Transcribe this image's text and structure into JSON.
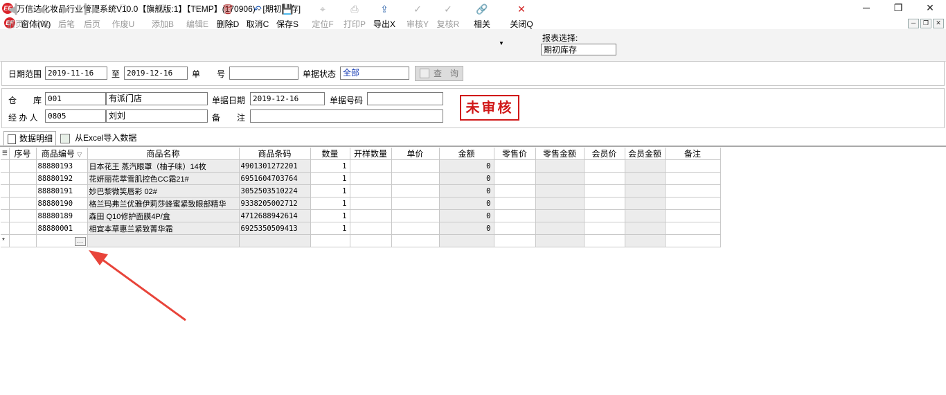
{
  "window": {
    "title": "万信达化妆品行业管理系统V10.0【旗舰版:1】【TEMP】(170906) - [期初库存]",
    "logo_text": "EF"
  },
  "menu": {
    "label": "窗体(W)"
  },
  "toolbar": {
    "buttons": [
      {
        "label": "前页",
        "icon": "◀▎",
        "enabled": false
      },
      {
        "label": "前笔",
        "icon": "◀",
        "enabled": false
      },
      {
        "label": "后笔",
        "icon": "▶",
        "enabled": false
      },
      {
        "label": "后页",
        "icon": "▎▶",
        "enabled": false
      },
      {
        "label": "作废U",
        "icon": "🗋",
        "enabled": false
      },
      {
        "label": "添加B",
        "icon": "🗋",
        "enabled": false
      },
      {
        "label": "编辑E",
        "icon": "✎",
        "enabled": false
      },
      {
        "label": "删除D",
        "icon": "🗑",
        "enabled": true
      },
      {
        "label": "取消C",
        "icon": "↶",
        "enabled": true
      },
      {
        "label": "保存S",
        "icon": "💾",
        "enabled": true
      },
      {
        "label": "定位F",
        "icon": "⌖",
        "enabled": false
      },
      {
        "label": "打印P",
        "icon": "⎙",
        "enabled": false
      },
      {
        "label": "导出X",
        "icon": "⇪",
        "enabled": true
      },
      {
        "label": "审核Y",
        "icon": "✓",
        "enabled": false
      },
      {
        "label": "复核R",
        "icon": "✓",
        "enabled": false
      },
      {
        "label": "相关",
        "icon": "🔗",
        "enabled": true
      },
      {
        "label": "关闭Q",
        "icon": "✕",
        "enabled": true
      }
    ],
    "report_label": "报表选择:",
    "report_value": "期初库存"
  },
  "filter": {
    "date_label": "日期范围",
    "date_from": "2019-11-16",
    "to_label": "至",
    "date_to": "2019-12-16",
    "docno_label": "单　　号",
    "docno_value": "",
    "status_label": "单据状态",
    "status_value": "全部",
    "query_label": "查　询"
  },
  "header": {
    "warehouse_label": "仓　　库",
    "warehouse_code": "001",
    "warehouse_name": "有派门店",
    "docdate_label": "单据日期",
    "docdate_value": "2019-12-16",
    "docnum_label": "单据号码",
    "docnum_value": "",
    "handler_label": "经 办 人",
    "handler_code": "0805",
    "handler_name": "刘刘",
    "remark_label": "备　　注",
    "remark_value": "",
    "stamp": "未审核"
  },
  "tabs": [
    {
      "label": "数据明细",
      "icon": "doc-icon"
    },
    {
      "label": "从Excel导入数据",
      "icon": "excel-icon"
    }
  ],
  "grid": {
    "columns": [
      "序号",
      "商品编号",
      "商品名称",
      "商品条码",
      "数量",
      "开样数量",
      "单价",
      "金额",
      "零售价",
      "零售金额",
      "会员价",
      "会员金额",
      "备注"
    ],
    "rows": [
      {
        "code": "88880193",
        "name": "日本花王 蒸汽眼罩（柚子味）14枚",
        "barcode": "4901301272201",
        "qty": "1",
        "amount": "0"
      },
      {
        "code": "88880192",
        "name": "花妍丽花萃雪肌控色CC霜21#",
        "barcode": "6951604703764",
        "qty": "1",
        "amount": "0"
      },
      {
        "code": "88880191",
        "name": "妙巴黎微笑唇彩 02#",
        "barcode": "3052503510224",
        "qty": "1",
        "amount": "0"
      },
      {
        "code": "88880190",
        "name": "格兰玛弗兰优雅伊莉莎蜂蜜紧致眼部精华",
        "barcode": "9338205002712",
        "qty": "1",
        "amount": "0"
      },
      {
        "code": "88880189",
        "name": "森田 Q10修护面膜4P/盒",
        "barcode": "4712688942614",
        "qty": "1",
        "amount": "0"
      },
      {
        "code": "88880001",
        "name": "相宜本草惠兰紧致菁华霜",
        "barcode": "6925350509413",
        "qty": "1",
        "amount": "0"
      }
    ],
    "new_row_marker": "*",
    "ellipsis": "…"
  }
}
